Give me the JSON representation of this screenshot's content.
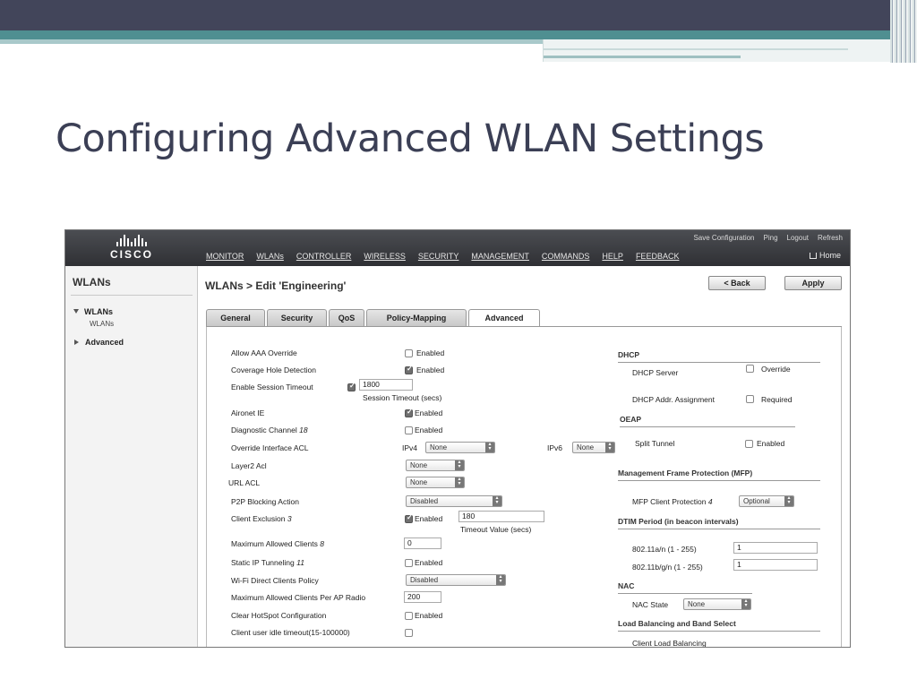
{
  "slide": {
    "title": "Configuring Advanced WLAN Settings"
  },
  "header": {
    "logo_text": "CISCO",
    "top_links": [
      "Save Configuration",
      "Ping",
      "Logout",
      "Refresh"
    ],
    "nav": [
      "MONITOR",
      "WLANs",
      "CONTROLLER",
      "WIRELESS",
      "SECURITY",
      "MANAGEMENT",
      "COMMANDS",
      "HELP",
      "FEEDBACK"
    ],
    "home": "Home"
  },
  "sidebar": {
    "title": "WLANs",
    "items": [
      {
        "label": "WLANs",
        "sub": "WLANs"
      },
      {
        "label": "Advanced"
      }
    ]
  },
  "page": {
    "breadcrumb": "WLANs > Edit  'Engineering'",
    "back_button": "< Back",
    "apply_button": "Apply",
    "tabs": [
      "General",
      "Security",
      "QoS",
      "Policy-Mapping",
      "Advanced"
    ]
  },
  "left": {
    "allow_aaa": {
      "label": "Allow AAA Override",
      "check": "Enabled"
    },
    "coverage": {
      "label": "Coverage Hole Detection",
      "check": "Enabled"
    },
    "session": {
      "label": "Enable Session Timeout",
      "value": "1800",
      "caption": "Session Timeout (secs)"
    },
    "aironet": {
      "label": "Aironet IE",
      "check": "Enabled"
    },
    "diag": {
      "label": "Diagnostic Channel",
      "mark": "18",
      "check": "Enabled"
    },
    "override_acl": {
      "label": "Override Interface ACL",
      "ipv4": "IPv4",
      "ipv4_value": "None",
      "ipv6": "IPv6",
      "ipv6_value": "None"
    },
    "layer2": {
      "label": "Layer2 Acl",
      "value": "None"
    },
    "url_acl": {
      "label": "URL ACL",
      "value": "None"
    },
    "p2p": {
      "label": "P2P Blocking Action",
      "value": "Disabled"
    },
    "client_excl": {
      "label": "Client Exclusion",
      "mark": "3",
      "check": "Enabled",
      "value": "180",
      "caption": "Timeout Value (secs)"
    },
    "max_clients": {
      "label": "Maximum Allowed Clients",
      "mark": "8",
      "value": "0"
    },
    "static_ip": {
      "label": "Static IP Tunneling",
      "mark": "11",
      "check": "Enabled"
    },
    "wifi_direct": {
      "label": "Wi-Fi Direct Clients Policy",
      "value": "Disabled"
    },
    "max_per_ap": {
      "label": "Maximum Allowed Clients Per AP Radio",
      "value": "200"
    },
    "hotspot": {
      "label": "Clear HotSpot Configuration",
      "check": "Enabled"
    },
    "idle": {
      "label": "Client user idle timeout(15-100000)"
    }
  },
  "right": {
    "dhcp": {
      "title": "DHCP",
      "server": "DHCP Server",
      "override": "Override",
      "assign": "DHCP Addr. Assignment",
      "required": "Required"
    },
    "oeap": {
      "title": "OEAP",
      "split": "Split Tunnel",
      "enabled": "Enabled"
    },
    "mfp": {
      "title": "Management Frame Protection (MFP)",
      "label": "MFP Client Protection",
      "mark": "4",
      "value": "Optional"
    },
    "dtim": {
      "title": "DTIM Period (in beacon intervals)",
      "a_label": "802.11a/n (1 - 255)",
      "a_value": "1",
      "b_label": "802.11b/g/n (1 - 255)",
      "b_value": "1"
    },
    "nac": {
      "title": "NAC",
      "label": "NAC State",
      "value": "None"
    },
    "lb": {
      "title": "Load Balancing and Band Select",
      "label": "Client Load Balancing"
    }
  }
}
